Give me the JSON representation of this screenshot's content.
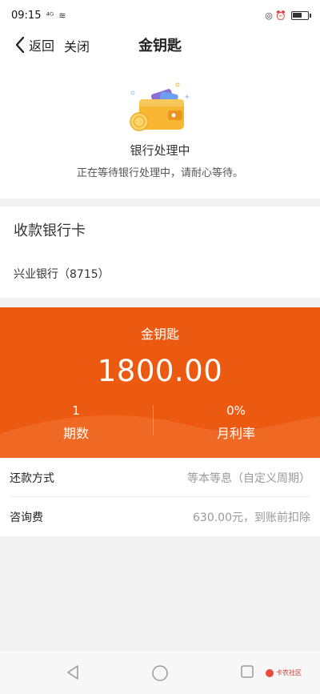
{
  "status_bar": {
    "time": "09:15",
    "signal_glyph": "⁴ᴳ",
    "wifi_glyph": "≋",
    "right_icons": "◎ ⏰"
  },
  "nav": {
    "back_label": "返回",
    "close_label": "关闭",
    "title": "金钥匙"
  },
  "status_panel": {
    "title": "银行处理中",
    "description": "正在等待银行处理中，请耐心等待。"
  },
  "bank": {
    "heading": "收款银行卡",
    "value": "兴业银行（8715）"
  },
  "loan": {
    "name": "金钥匙",
    "amount": "1800.00",
    "term_value": "1",
    "term_label": "期数",
    "rate_value": "0%",
    "rate_label": "月利率"
  },
  "details": [
    {
      "label": "还款方式",
      "value": "等本等息（自定义周期）"
    },
    {
      "label": "咨询费",
      "value": "630.00元，到账前扣除"
    }
  ],
  "watermark": {
    "text": "卡农社区"
  },
  "colors": {
    "accent_orange": "#ec5a12",
    "wallet_yellow": "#f7b733",
    "card_purple": "#8b6fd6"
  }
}
